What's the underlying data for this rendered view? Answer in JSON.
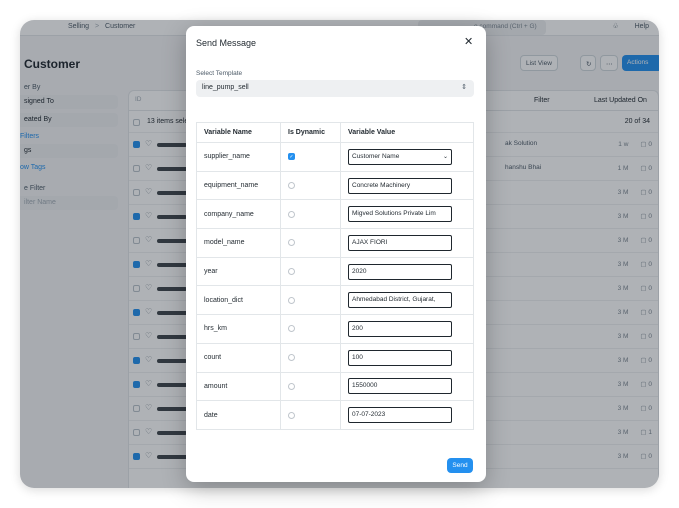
{
  "navbar": {
    "breadcrumb_selling": "Selling",
    "breadcrumb_sep": ">",
    "breadcrumb_customer": "Customer",
    "search_hint": "e command (Ctrl + G)",
    "help_label": "Help"
  },
  "page": {
    "title": "Customer",
    "list_view_label": "List View",
    "actions_label": "Actions"
  },
  "sidebar": {
    "filter_by": "er By",
    "assigned_to": "signed To",
    "created_by": "eated By",
    "edit_filters": "Filters",
    "tags": "gs",
    "show_tags": "ow Tags",
    "save_filter": "e Filter",
    "filter_name": "ilter Name"
  },
  "list": {
    "id_placeholder": "ID",
    "filter_label": "Filter",
    "sort_label": "Last Updated On",
    "items_selected": "13 items sele",
    "page_count": "20 of 34",
    "rows": [
      {
        "checked": true,
        "snippet": "ak Solution",
        "age": "1 w",
        "comments": "0"
      },
      {
        "checked": false,
        "snippet": "hanshu Bhai",
        "age": "1 M",
        "comments": "0"
      },
      {
        "checked": false,
        "snippet": "",
        "age": "3 M",
        "comments": "0"
      },
      {
        "checked": true,
        "snippet": "",
        "age": "3 M",
        "comments": "0"
      },
      {
        "checked": false,
        "snippet": "",
        "age": "3 M",
        "comments": "0"
      },
      {
        "checked": true,
        "snippet": "",
        "age": "3 M",
        "comments": "0"
      },
      {
        "checked": false,
        "snippet": "",
        "age": "3 M",
        "comments": "0"
      },
      {
        "checked": true,
        "snippet": "",
        "age": "3 M",
        "comments": "0"
      },
      {
        "checked": false,
        "snippet": "",
        "age": "3 M",
        "comments": "0"
      },
      {
        "checked": true,
        "snippet": "",
        "age": "3 M",
        "comments": "0"
      },
      {
        "checked": true,
        "snippet": "",
        "age": "3 M",
        "comments": "0"
      },
      {
        "checked": false,
        "snippet": "",
        "age": "3 M",
        "comments": "0"
      },
      {
        "checked": false,
        "snippet": "",
        "age": "3 M",
        "comments": "1"
      },
      {
        "checked": true,
        "snippet": "",
        "age": "3 M",
        "comments": "0"
      }
    ]
  },
  "modal": {
    "title": "Send Message",
    "close_icon": "close-icon",
    "template_label": "Select Template",
    "template_value": "line_pump_sell",
    "col_name": "Variable Name",
    "col_dynamic": "Is Dynamic",
    "col_value": "Variable Value",
    "variables": [
      {
        "name": "supplier_name",
        "dynamic": true,
        "value": "Customer Name",
        "is_select": true
      },
      {
        "name": "equipment_name",
        "dynamic": false,
        "value": "Concrete Machinery",
        "is_select": false
      },
      {
        "name": "company_name",
        "dynamic": false,
        "value": "Migved Solutions Private Lim",
        "is_select": false
      },
      {
        "name": "model_name",
        "dynamic": false,
        "value": "AJAX FIORI",
        "is_select": false
      },
      {
        "name": "year",
        "dynamic": false,
        "value": "2020",
        "is_select": false
      },
      {
        "name": "location_dict",
        "dynamic": false,
        "value": "Ahmedabad District, Gujarat,",
        "is_select": false
      },
      {
        "name": "hrs_km",
        "dynamic": false,
        "value": "200",
        "is_select": false
      },
      {
        "name": "count",
        "dynamic": false,
        "value": "100",
        "is_select": false
      },
      {
        "name": "amount",
        "dynamic": false,
        "value": "1550000",
        "is_select": false
      },
      {
        "name": "date",
        "dynamic": false,
        "value": "07-07-2023",
        "is_select": false
      }
    ],
    "send_label": "Send"
  },
  "colors": {
    "accent": "#2490ef",
    "overlay": "rgba(20,30,40,.34)"
  }
}
